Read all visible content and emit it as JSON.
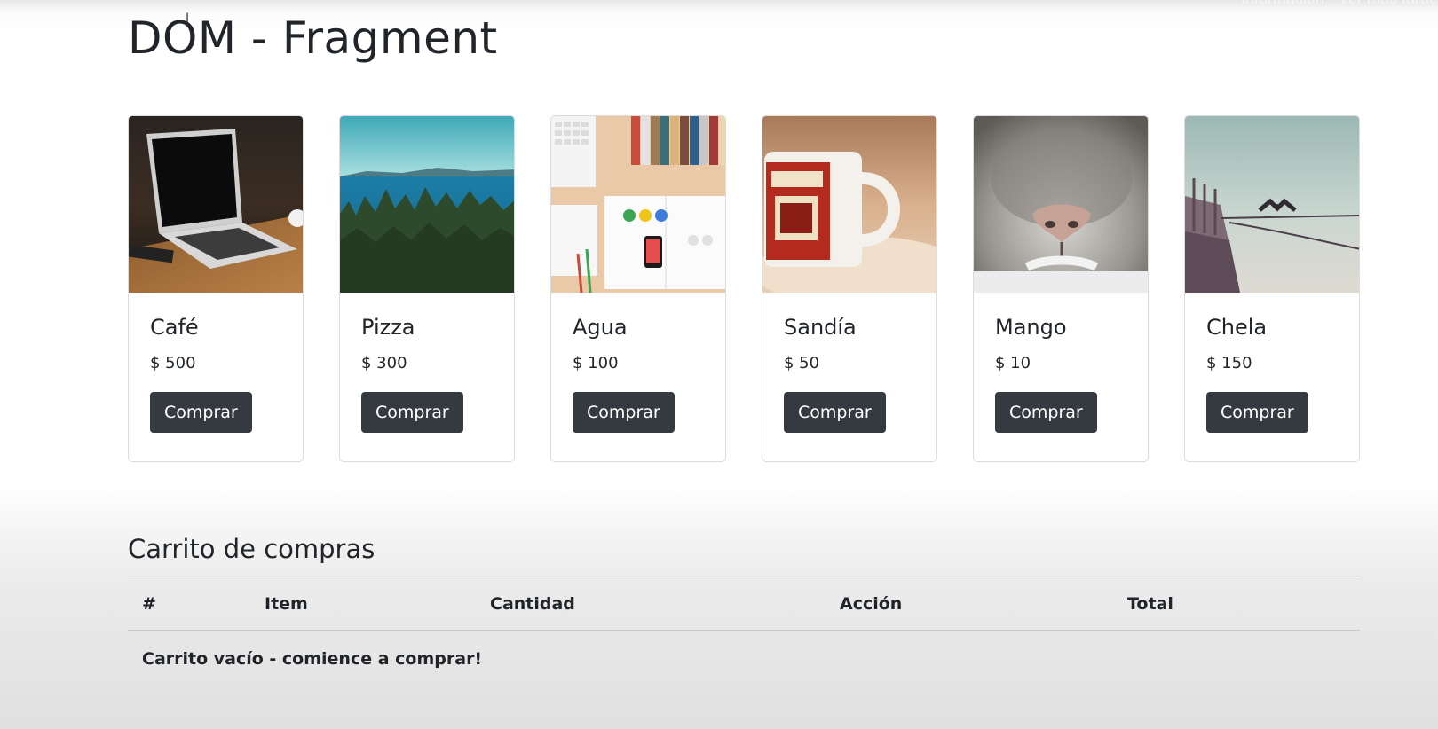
{
  "page": {
    "title": "DOM - Fragment",
    "overlay_text": "Información · Ver más tarde"
  },
  "products": [
    {
      "name": "Café",
      "price": "$ 500",
      "button": "Comprar",
      "image": "laptop-on-desk"
    },
    {
      "name": "Pizza",
      "price": "$ 300",
      "button": "Comprar",
      "image": "forest-and-sea"
    },
    {
      "name": "Agua",
      "price": "$ 100",
      "button": "Comprar",
      "image": "desk-with-books"
    },
    {
      "name": "Sandía",
      "price": "$ 50",
      "button": "Comprar",
      "image": "coffee-mug"
    },
    {
      "name": "Mango",
      "price": "$ 10",
      "button": "Comprar",
      "image": "cat-nose"
    },
    {
      "name": "Chela",
      "price": "$ 150",
      "button": "Comprar",
      "image": "bird-on-pier"
    }
  ],
  "cart": {
    "title": "Carrito de compras",
    "columns": [
      "#",
      "Item",
      "Cantidad",
      "Acción",
      "Total"
    ],
    "empty_message": "Carrito vacío - comience a comprar!"
  },
  "colors": {
    "button_bg": "#343a40",
    "text": "#212529"
  }
}
